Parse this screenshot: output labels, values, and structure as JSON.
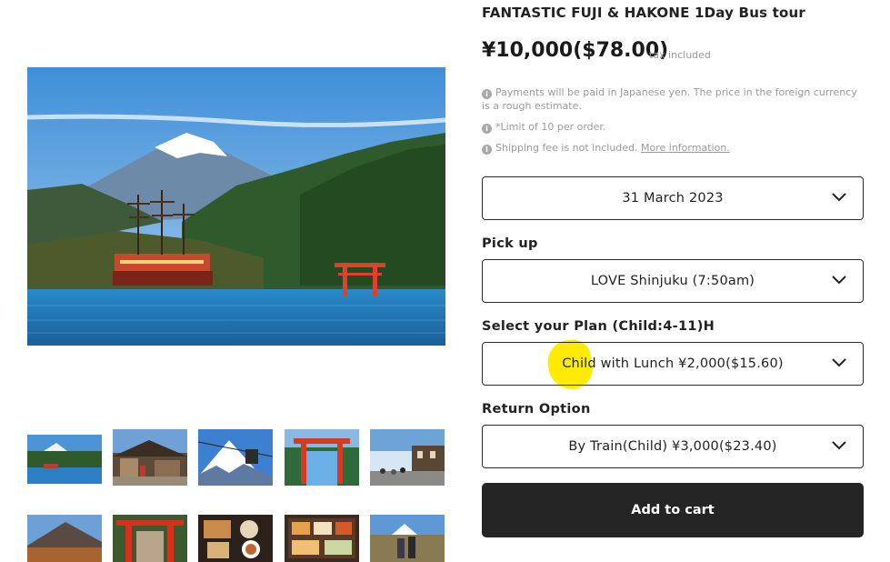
{
  "product": {
    "title": "FANTASTIC FUJI & HAKONE 1Day Bus tour",
    "price": "¥10,000($78.00)",
    "tax_note": "tax included"
  },
  "notes": {
    "payment": "Payments will be paid in Japanese yen. The price in the foreign currency is a rough estimate.",
    "limit": "*Limit of 10 per order.",
    "shipping": "Shipping fee is not included.",
    "more_info": "More information."
  },
  "date_select": {
    "value": "31 March 2023"
  },
  "pickup": {
    "label": "Pick up",
    "value": "LOVE Shinjuku (7:50am)"
  },
  "plan": {
    "label": "Select your Plan (Child:4-11)H",
    "value": "Child with Lunch ¥2,000($15.60)"
  },
  "return_option": {
    "label": "Return Option",
    "value": "By Train(Child) ¥3,000($23.40)"
  },
  "cart": {
    "label": "Add to cart"
  },
  "gallery": {
    "main_image": "lake-ashi-pirate-ship-mount-fuji-photo",
    "thumbnails": [
      "lake-pirate-ship-thumbnail",
      "temple-village-thumbnail",
      "fuji-ropeway-thumbnail",
      "torii-gate-thumbnail",
      "street-crowd-thumbnail",
      "mountain-autumn-thumbnail",
      "red-shrine-gate-thumbnail",
      "lunch-set-thumbnail",
      "food-tray-thumbnail",
      "tourists-fuji-thumbnail"
    ]
  },
  "colors": {
    "button_bg": "#252525",
    "highlight": "#ffeb00",
    "note_text": "#9a9a9a"
  }
}
